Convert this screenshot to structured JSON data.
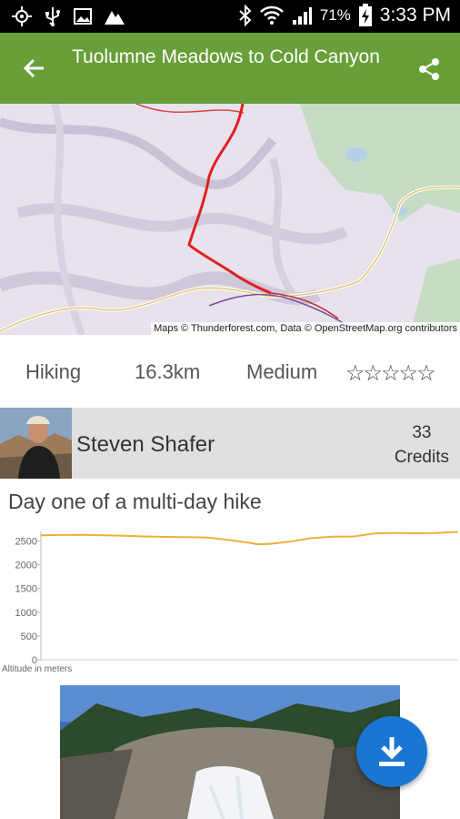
{
  "status_bar": {
    "battery_percent": "71%",
    "time": "3:33 PM"
  },
  "app_bar": {
    "title": "Tuolumne Meadows to Cold Canyon"
  },
  "map": {
    "attribution": "Maps © Thunderforest.com, Data © OpenStreetMap.org contributors"
  },
  "stats": {
    "activity": "Hiking",
    "distance": "16.3km",
    "difficulty": "Medium",
    "rating": 0,
    "rating_max": 5
  },
  "author": {
    "name": "Steven Shafer",
    "credits_count": "33",
    "credits_label": "Credits"
  },
  "description": "Day one of a multi-day hike",
  "chart_data": {
    "type": "line",
    "ylabel": "Altitude in meters",
    "ylim": [
      0,
      2700
    ],
    "yticks": [
      0,
      500,
      1000,
      1500,
      2000,
      2500
    ],
    "x": [
      0,
      0.05,
      0.1,
      0.15,
      0.2,
      0.25,
      0.3,
      0.35,
      0.4,
      0.45,
      0.5,
      0.52,
      0.55,
      0.6,
      0.65,
      0.7,
      0.75,
      0.8,
      0.85,
      0.9,
      0.95,
      1.0
    ],
    "series": [
      {
        "values": [
          2620,
          2625,
          2630,
          2620,
          2610,
          2595,
          2585,
          2580,
          2570,
          2520,
          2460,
          2430,
          2440,
          2490,
          2560,
          2590,
          2595,
          2660,
          2670,
          2660,
          2670,
          2690
        ],
        "color": "#f0b03a"
      }
    ]
  },
  "fab": {
    "icon": "download-icon"
  }
}
